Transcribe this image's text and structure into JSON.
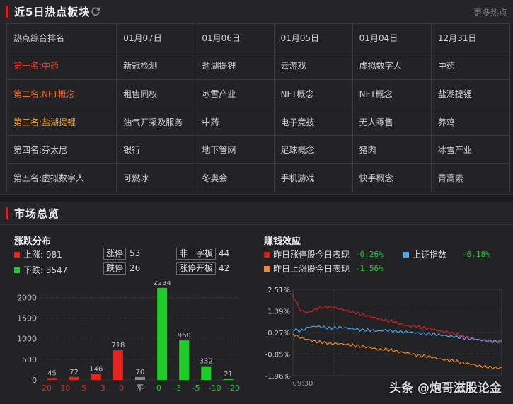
{
  "hot": {
    "title": "近5日热点板块",
    "more": "更多热点",
    "header": [
      "热点综合排名",
      "01月07日",
      "01月06日",
      "01月05日",
      "01月04日",
      "12月31日"
    ],
    "rows": [
      [
        "第一名:中药",
        "新冠检测",
        "盐湖提锂",
        "云游戏",
        "虚拟数字人",
        "中药"
      ],
      [
        "第二名:NFT概念",
        "租售同权",
        "冰雪产业",
        "NFT概念",
        "NFT概念",
        "盐湖提锂"
      ],
      [
        "第三名:盐湖提锂",
        "油气开采及服务",
        "中药",
        "电子竞技",
        "无人零售",
        "养鸡"
      ],
      [
        "第四名:芬太尼",
        "银行",
        "地下管网",
        "足球概念",
        "猪肉",
        "冰雪产业"
      ],
      [
        "第五名:虚拟数字人",
        "可燃冰",
        "冬奥会",
        "手机游戏",
        "快手概念",
        "青蒿素"
      ]
    ]
  },
  "market": {
    "title": "市场总览",
    "dist": {
      "title": "涨跌分布",
      "up_label": "上涨",
      "up_value": "981",
      "down_label": "下跌",
      "down_value": "3547",
      "limit_up_label": "涨停",
      "limit_up_value": "53",
      "limit_down_label": "跌停",
      "limit_down_value": "26",
      "one_word_label": "非一字板",
      "one_word_value": "44",
      "open_board_label": "涨停开板",
      "open_board_value": "42"
    },
    "effect": {
      "title": "赚钱效应",
      "items": [
        {
          "label": "昨日涨停股今日表现",
          "value": "-0.26%"
        },
        {
          "label": "上证指数",
          "value": "-0.18%"
        },
        {
          "label": "昨日上涨股今日表现",
          "value": "-1.56%"
        }
      ]
    },
    "watermark": "头条 @炮哥滋股论金"
  },
  "colors": {
    "red": "#e8231e",
    "green": "#1fcc2a",
    "gray": "#8a8a8a",
    "blue": "#4aa6ee",
    "orange": "#f08a22",
    "darkred": "#d42020"
  },
  "chart_data": [
    {
      "type": "bar",
      "categories": [
        "20",
        "10",
        "5",
        "3",
        "0",
        "平",
        "0",
        "-3",
        "-5",
        "-10",
        "-20"
      ],
      "bars": [
        {
          "label": "45",
          "value": 45,
          "color": "red"
        },
        {
          "label": "72",
          "value": 72,
          "color": "red"
        },
        {
          "label": "146",
          "value": 146,
          "color": "red"
        },
        {
          "label": "718",
          "value": 718,
          "color": "red"
        },
        {
          "label": "70",
          "value": 70,
          "color": "gray"
        },
        {
          "label": "2234",
          "value": 2234,
          "color": "green"
        },
        {
          "label": "960",
          "value": 960,
          "color": "green"
        },
        {
          "label": "332",
          "value": 332,
          "color": "green"
        },
        {
          "label": "21",
          "value": 21,
          "color": "green"
        }
      ],
      "yticks": [
        "0",
        "500",
        "1000",
        "1500",
        "2000"
      ],
      "ylim": [
        0,
        2300
      ],
      "grid": true
    },
    {
      "type": "line",
      "yticks": [
        "2.51%",
        "1.39%",
        "0.27%",
        "-0.85%",
        "-1.96%"
      ],
      "ylim": [
        -1.96,
        2.51
      ],
      "xticks": [
        "09:30"
      ],
      "series": [
        {
          "name": "昨日涨停股今日表现",
          "color": "darkred",
          "values": [
            2.2,
            1.4,
            1.3,
            1.5,
            1.6,
            1.6,
            1.5,
            1.4,
            1.3,
            1.2,
            1.1,
            1.0,
            0.9,
            0.85,
            0.7,
            0.6,
            0.6,
            0.5,
            0.45,
            0.35,
            0.3,
            0.2,
            0.1,
            0.0,
            -0.1,
            -0.15,
            -0.2,
            -0.26
          ]
        },
        {
          "name": "上证指数",
          "color": "blue",
          "values": [
            0.45,
            0.35,
            0.55,
            0.6,
            0.55,
            0.5,
            0.55,
            0.5,
            0.45,
            0.4,
            0.4,
            0.35,
            0.4,
            0.35,
            0.3,
            0.3,
            0.25,
            0.2,
            0.2,
            0.15,
            0.1,
            0.05,
            0.0,
            -0.05,
            -0.1,
            -0.15,
            -0.18,
            -0.18
          ]
        },
        {
          "name": "昨日上涨股今日表现",
          "color": "orange",
          "values": [
            0.2,
            0.0,
            -0.1,
            -0.2,
            -0.25,
            -0.3,
            -0.3,
            -0.35,
            -0.4,
            -0.45,
            -0.5,
            -0.6,
            -0.6,
            -0.65,
            -0.75,
            -0.8,
            -0.9,
            -0.95,
            -1.0,
            -1.1,
            -1.15,
            -1.2,
            -1.3,
            -1.35,
            -1.45,
            -1.5,
            -1.55,
            -1.56
          ]
        }
      ]
    }
  ]
}
